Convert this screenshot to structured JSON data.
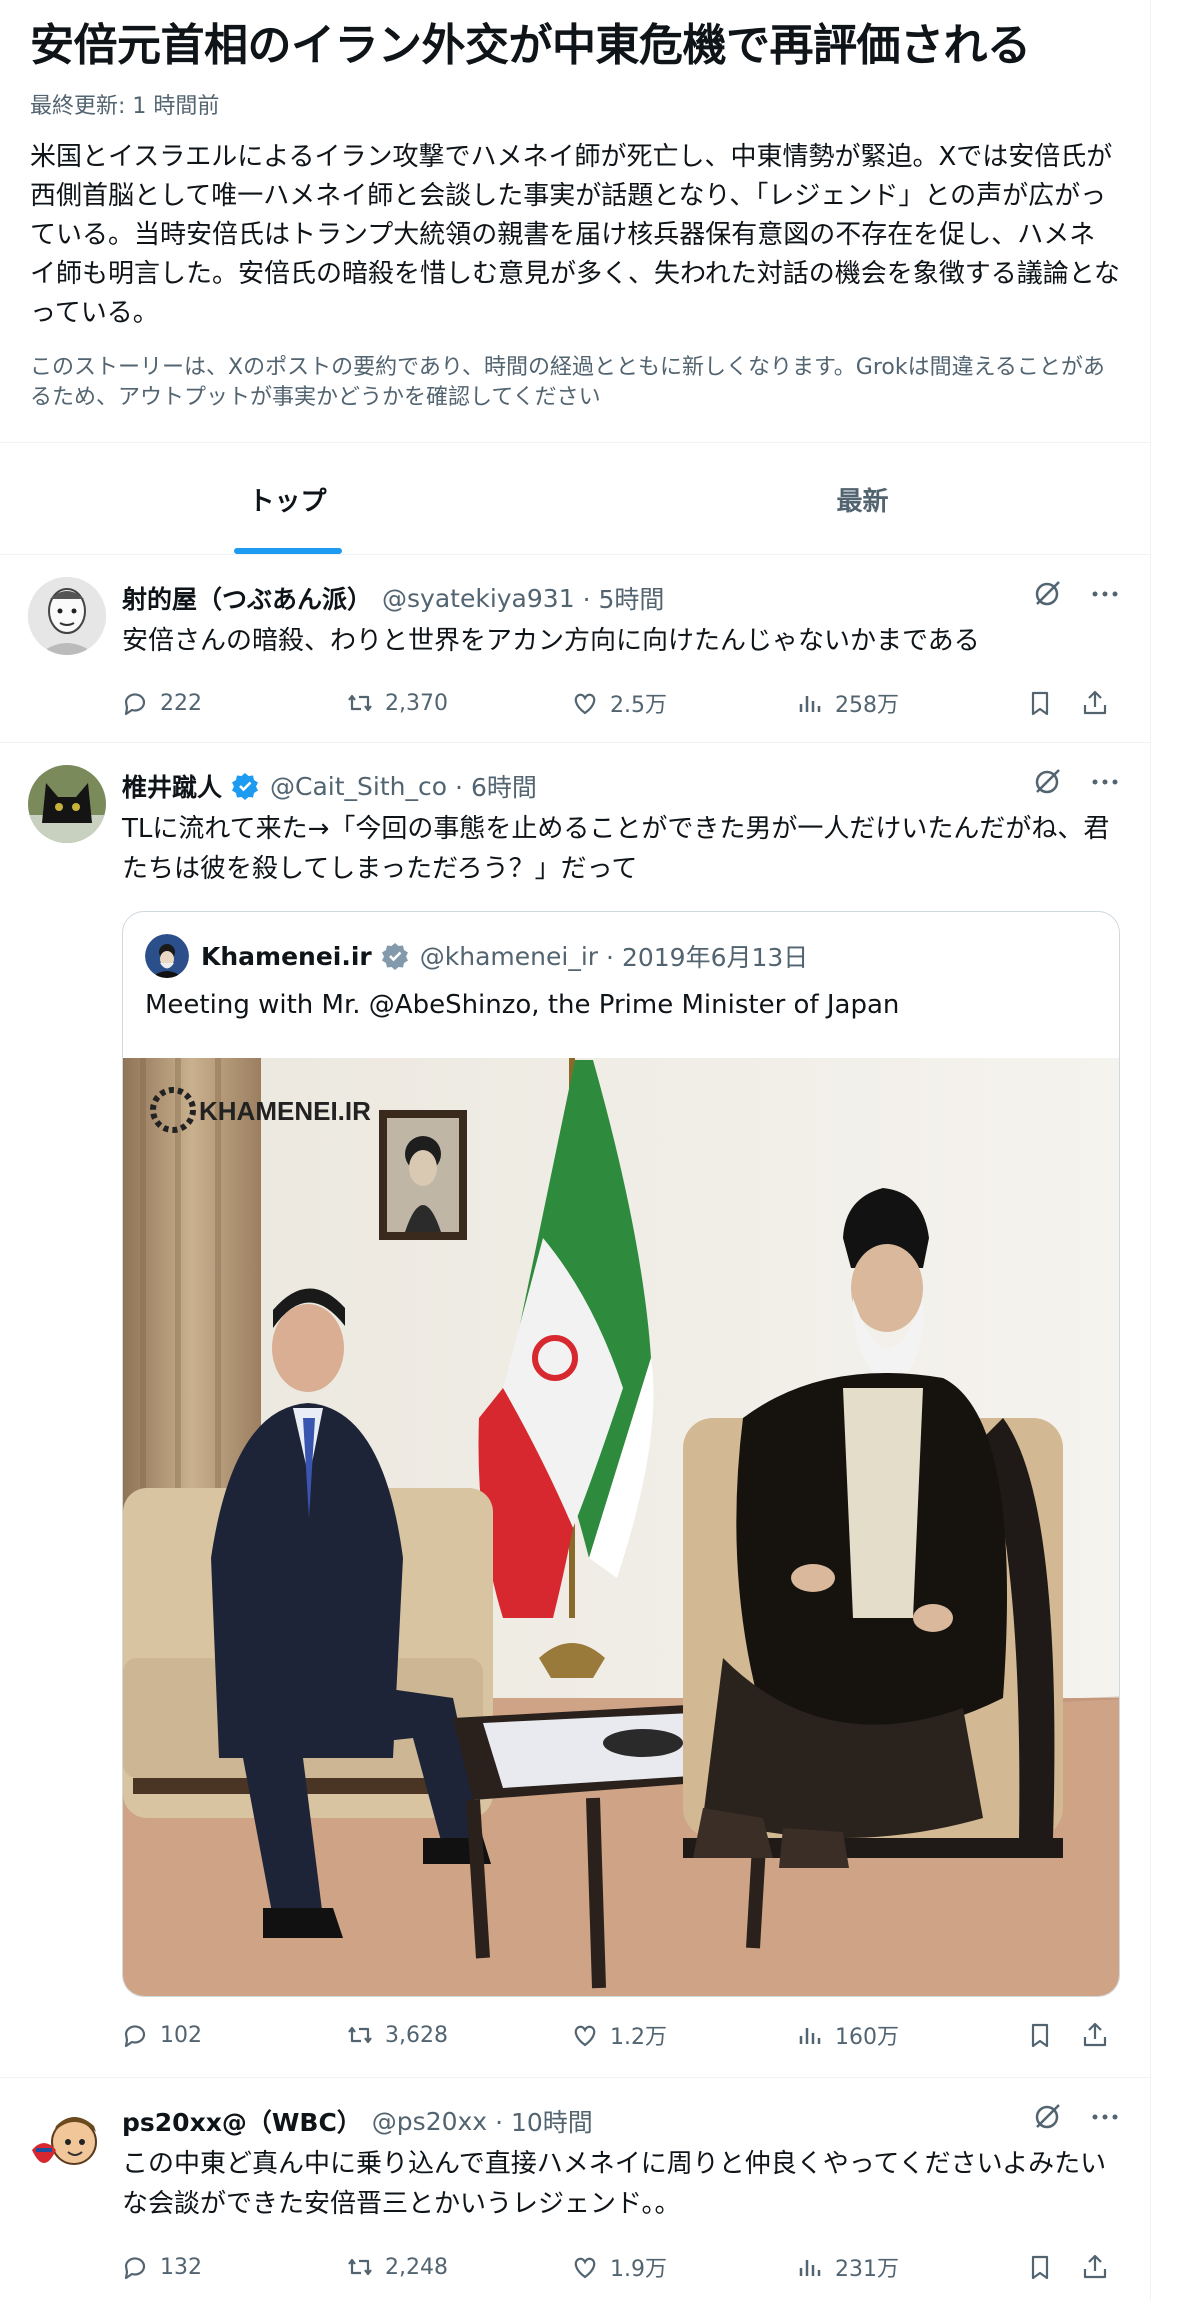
{
  "story": {
    "title": "安倍元首相のイラン外交が中東危機で再評価される",
    "updated": "最終更新: 1 時間前",
    "summary": "米国とイスラエルによるイラン攻撃でハメネイ師が死亡し、中東情勢が緊迫。Xでは安倍氏が西側首脳として唯一ハメネイ師と会談した事実が話題となり、「レジェンド」との声が広がっている。当時安倍氏はトランプ大統領の親書を届け核兵器保有意図の不存在を促し、ハメネイ師も明言した。安倍氏の暗殺を惜しむ意見が多く、失われた対話の機会を象徴する議論となっている。",
    "disclaimer": "このストーリーは、Xのポストの要約であり、時間の経過とともに新しくなります。Grokは間違えることがあるため、アウトプットが事実かどうかを確認してください"
  },
  "tabs": [
    {
      "label": "トップ",
      "active": true
    },
    {
      "label": "最新",
      "active": false
    }
  ],
  "posts": [
    {
      "name": "射的屋（つぶあん派）",
      "handle": "@syatekiya931",
      "time": "· 5時間",
      "text": "安倍さんの暗殺、わりと世界をアカン方向に向けたんじゃないかまである",
      "replies": "222",
      "reposts": "2,370",
      "likes": "2.5万",
      "views": "258万"
    },
    {
      "name": "椎井蹴人",
      "handle": "@Cait_Sith_co",
      "time": "· 6時間",
      "text": "TLに流れて来た→「今回の事態を止めることができた男が一人だけいたんだがね、君たちは彼を殺してしまっただろう？」だって",
      "replies": "102",
      "reposts": "3,628",
      "likes": "1.2万",
      "views": "160万",
      "quote": {
        "name": "Khamenei.ir",
        "handle": "@khamenei_ir",
        "time": "· 2019年6月13日",
        "text": "Meeting with Mr. @AbeShinzo, the Prime Minister of Japan",
        "watermark": "KHAMENEI.IR"
      }
    },
    {
      "name": "ps20xx@（WBC）",
      "handle": "@ps20xx",
      "time": "· 10時間",
      "text": "この中東ど真ん中に乗り込んで直接ハメネイに周りと仲良くやってくださいよみたいな会談ができた安倍晋三とかいうレジェンド。。",
      "replies": "132",
      "reposts": "2,248",
      "likes": "1.9万",
      "views": "231万"
    }
  ],
  "colors": {
    "accent": "#1d9bf0",
    "muted": "#536471",
    "text": "#0f1419"
  },
  "icons": [
    "grok-icon",
    "more-icon",
    "reply-icon",
    "repost-icon",
    "like-icon",
    "views-icon",
    "bookmark-icon",
    "share-icon",
    "verified-icon"
  ]
}
